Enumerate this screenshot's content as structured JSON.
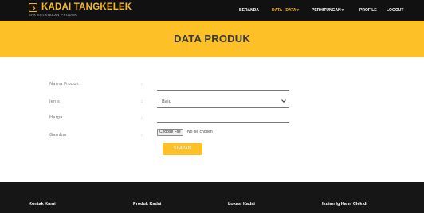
{
  "brand": {
    "title": "KADAI TANGKELEK",
    "subtitle": "SPK KELAYAKAN PRODUK",
    "accent": "#f5b820"
  },
  "nav": {
    "items": [
      {
        "label": "BERANDA",
        "dropdown": false,
        "active": false
      },
      {
        "label": "DATA - DATA",
        "dropdown": true,
        "active": true
      },
      {
        "label": "PERHITUNGAN",
        "dropdown": true,
        "active": false
      },
      {
        "label": "PROFILE",
        "dropdown": false,
        "active": false
      },
      {
        "label": "LOGOUT",
        "dropdown": false,
        "active": false
      }
    ],
    "caret": "▾"
  },
  "banner": {
    "title": "DATA PRODUK",
    "color": "#fdc027"
  },
  "form": {
    "colon": ":",
    "nama_produk": {
      "label": "Nama Produk",
      "value": ""
    },
    "jenis": {
      "label": "Jenis",
      "selected": "Baju"
    },
    "harga": {
      "label": "Harga",
      "value": ""
    },
    "gambar": {
      "label": "Gambar",
      "button": "Choose File",
      "status": "No file chosen"
    },
    "submit": "SIMPAN"
  },
  "footer": {
    "columns": [
      "Kontak Kami",
      "Produk Kadai",
      "Lokasi Kadai",
      "Ikuian Ig Kami Clek di"
    ]
  }
}
